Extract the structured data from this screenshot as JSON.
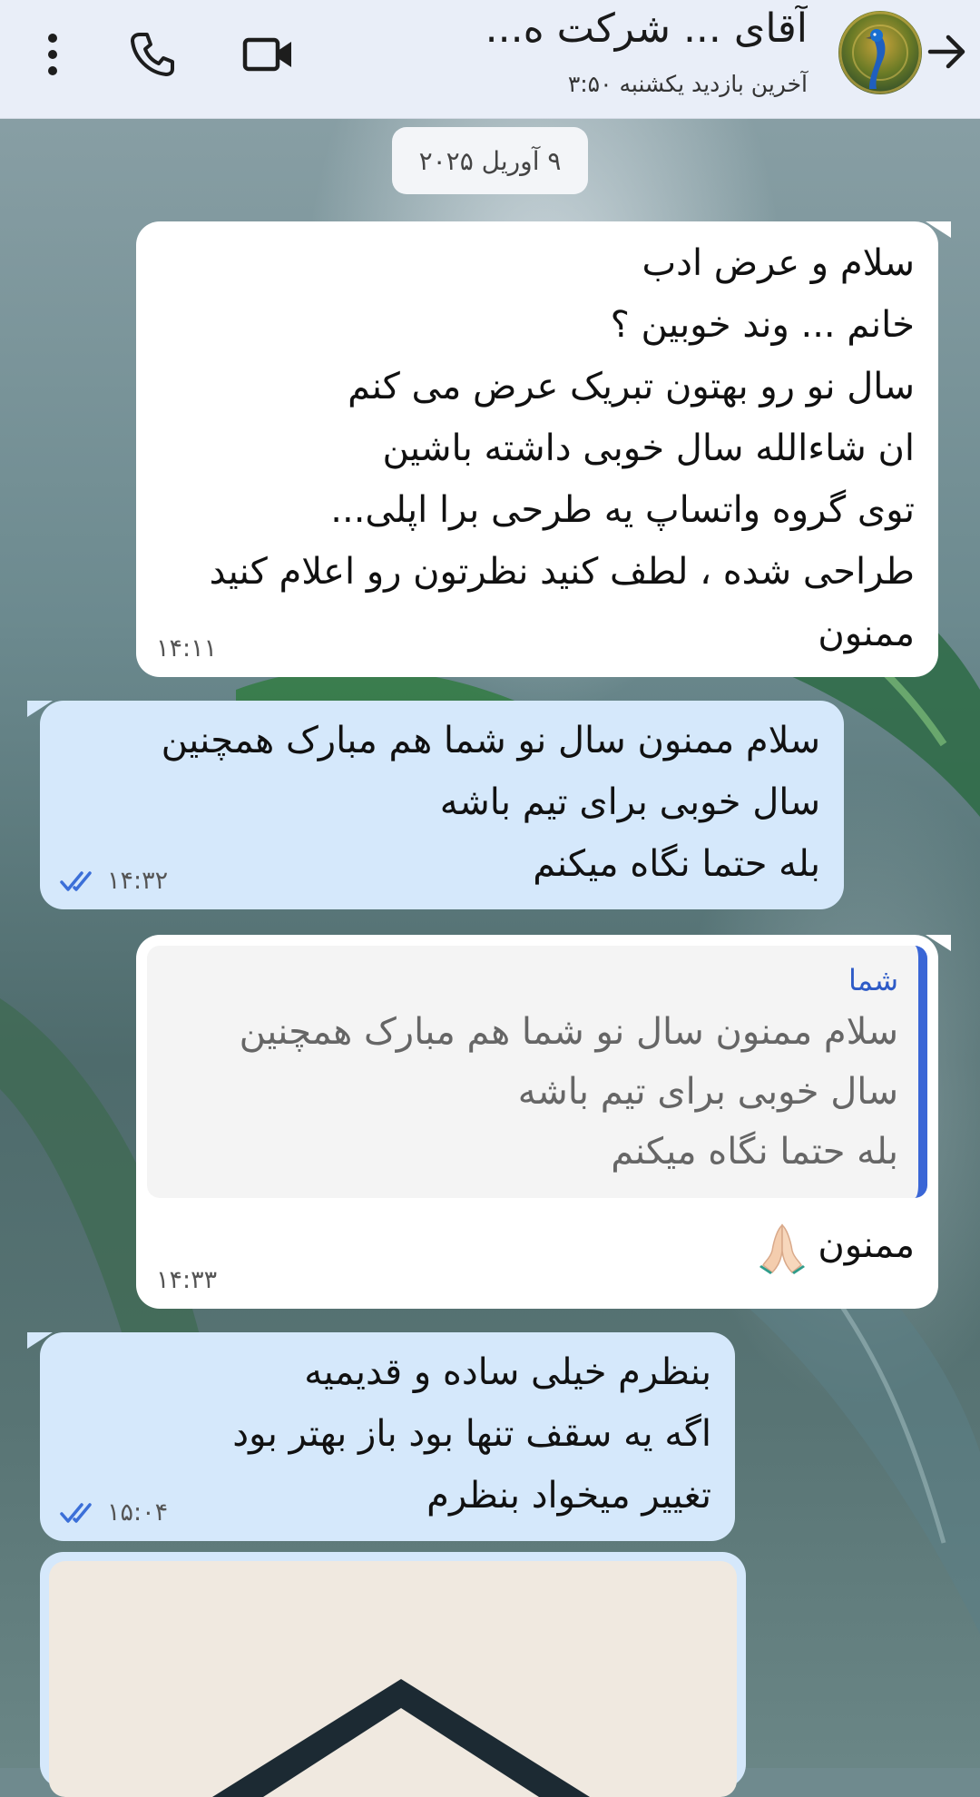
{
  "header": {
    "contact_name": "آقای ... شرکت ه...",
    "last_seen": "آخرین بازدید یکشنبه ۳:۵۰",
    "icons": {
      "back": "arrow-right-icon",
      "video": "video-call-icon",
      "call": "phone-icon",
      "menu": "more-vertical-icon"
    }
  },
  "date_chip": "۹ آوریل ۲۰۲۵",
  "messages": [
    {
      "direction": "incoming",
      "lines": [
        "سلام و عرض ادب",
        "خانم ... وند خوبین ؟",
        "سال نو رو بهتون تبریک عرض می کنم",
        "ان شاءالله سال خوبی داشته باشین",
        "توی گروه واتساپ یه طرحی برا اپلی...",
        "طراحی شده ، لطف کنید نظرتون رو اعلام کنید",
        "ممنون"
      ],
      "time": "۱۴:۱۱"
    },
    {
      "direction": "outgoing",
      "lines": [
        "سلام ممنون سال نو شما هم مبارک همچنین",
        "سال خوبی برای تیم باشه",
        "بله حتما نگاه میکنم"
      ],
      "time": "۱۴:۳۲",
      "status": "read"
    },
    {
      "direction": "incoming",
      "quote": {
        "author": "شما",
        "lines": [
          "سلام ممنون سال نو شما هم مبارک همچنین",
          "سال خوبی برای تیم باشه",
          "بله حتما نگاه میکنم"
        ]
      },
      "text": "ممنون",
      "emoji": "folded-hands-emoji",
      "time": "۱۴:۳۳"
    },
    {
      "direction": "outgoing",
      "lines": [
        "بنظرم خیلی ساده و قدیمیه",
        "اگه یه سقف تنها بود باز بهتر بود",
        "تغییر میخواد بنظرم"
      ],
      "time": "۱۵:۰۴",
      "status": "read"
    },
    {
      "direction": "outgoing",
      "type": "image"
    }
  ],
  "colors": {
    "header_bg": "#e9eef8",
    "incoming_bubble": "#ffffff",
    "outgoing_bubble": "#d5e8fb",
    "read_ticks": "#3b6fd8",
    "quote_bar": "#3a66d6"
  }
}
